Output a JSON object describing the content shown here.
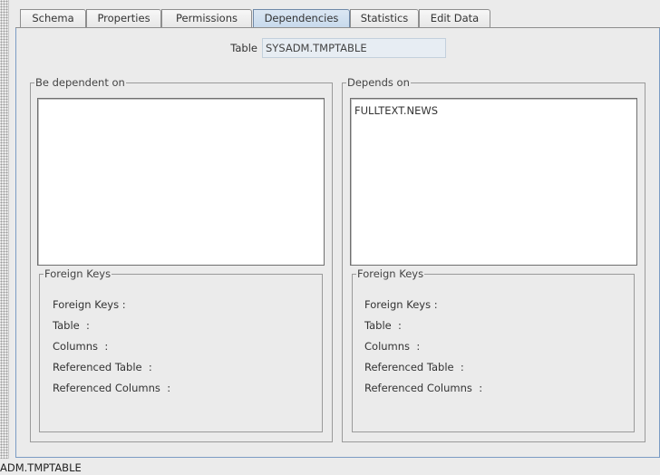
{
  "tabs": [
    {
      "label": "Schema"
    },
    {
      "label": "Properties"
    },
    {
      "label": "Permissions"
    },
    {
      "label": "Dependencies"
    },
    {
      "label": "Statistics"
    },
    {
      "label": "Edit Data"
    }
  ],
  "table": {
    "label": "Table",
    "value": "SYSADM.TMPTABLE"
  },
  "left_group": {
    "title": "Be dependent on",
    "items": [],
    "fk_title": "Foreign Keys",
    "fk_fields": [
      "Foreign Keys :",
      "Table  :",
      "Columns  :",
      "Referenced Table  :",
      "Referenced Columns  :"
    ]
  },
  "right_group": {
    "title": "Depends on",
    "items": [
      "FULLTEXT.NEWS"
    ],
    "fk_title": "Foreign Keys",
    "fk_fields": [
      "Foreign Keys :",
      "Table  :",
      "Columns  :",
      "Referenced Table  :",
      "Referenced Columns  :"
    ]
  },
  "status_text": "ADM.TMPTABLE"
}
